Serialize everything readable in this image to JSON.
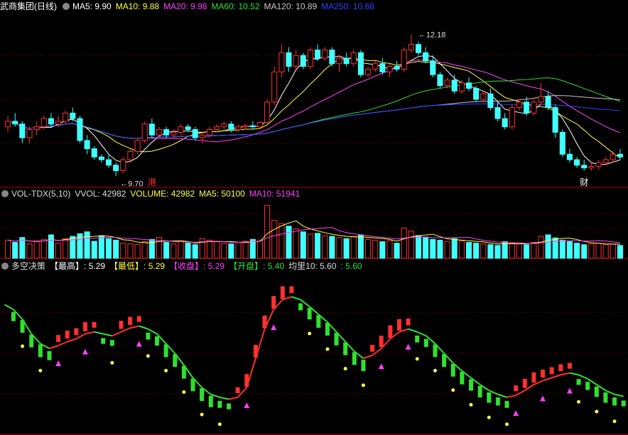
{
  "colors": {
    "up": "#ff3030",
    "down": "#40ffff",
    "ma5": "#ffffff",
    "ma10": "#ffff40",
    "ma20": "#ff40ff",
    "ma60": "#30e030",
    "ma120": "#c8c8c8",
    "ma250": "#3040ff",
    "grid": "#8b0000"
  },
  "price_panel": {
    "stock_name": "武商集团(日线)",
    "legend": [
      {
        "label": "MA5: 9.90",
        "color": "#ffffff"
      },
      {
        "label": "MA10: 9.88",
        "color": "#ffff40"
      },
      {
        "label": "MA20: 9.98",
        "color": "#ff40ff"
      },
      {
        "label": "MA60: 10.52",
        "color": "#30e030"
      },
      {
        "label": "MA120: 10.89",
        "color": "#c8c8c8"
      },
      {
        "label": "MA250: 10.68",
        "color": "#3040ff"
      }
    ],
    "high_marker": "12.18",
    "low_marker": "9.70",
    "event_marks": [
      "港",
      "财"
    ]
  },
  "volume_panel": {
    "legend": [
      {
        "label": "VOL-TDX(5,10)",
        "color": "#dddddd"
      },
      {
        "label": "VVOL: 42982",
        "color": "#dddddd"
      },
      {
        "label": "VOLUME: 42982",
        "color": "#ffff40"
      },
      {
        "label": "MA5: 50100",
        "color": "#ffff40"
      },
      {
        "label": "MA10: 51941",
        "color": "#ff40ff"
      }
    ]
  },
  "indicator_panel": {
    "legend": [
      {
        "label": "多空决策",
        "color": "#dddddd"
      },
      {
        "label": "【最高】: 5.29",
        "color": "#ffffff"
      },
      {
        "label": "【最低】: 5.29",
        "color": "#ffff40"
      },
      {
        "label": "【收盘】: 5.29",
        "color": "#ff40ff"
      },
      {
        "label": "【开盘】: 5.40",
        "color": "#30e030"
      },
      {
        "label": "均里10: 5.60",
        "color": "#dddddd"
      },
      {
        "label": ": 5.60",
        "color": "#30e030"
      }
    ]
  },
  "chart_data": [
    {
      "type": "candlestick",
      "title": "武商集团(日线)",
      "ylim": [
        9.5,
        12.5
      ],
      "ohlc": [
        [
          10.5,
          10.7,
          10.4,
          10.6
        ],
        [
          10.6,
          10.75,
          10.5,
          10.55
        ],
        [
          10.55,
          10.6,
          10.2,
          10.3
        ],
        [
          10.3,
          10.5,
          10.2,
          10.45
        ],
        [
          10.45,
          10.6,
          10.35,
          10.5
        ],
        [
          10.5,
          10.7,
          10.45,
          10.65
        ],
        [
          10.65,
          10.75,
          10.5,
          10.55
        ],
        [
          10.55,
          10.7,
          10.5,
          10.6
        ],
        [
          10.6,
          10.8,
          10.55,
          10.75
        ],
        [
          10.75,
          10.85,
          10.6,
          10.65
        ],
        [
          10.65,
          10.7,
          10.2,
          10.25
        ],
        [
          10.25,
          10.35,
          10.0,
          10.1
        ],
        [
          10.1,
          10.15,
          9.9,
          9.95
        ],
        [
          9.95,
          10.0,
          9.85,
          9.9
        ],
        [
          9.9,
          10.0,
          9.75,
          9.8
        ],
        [
          9.8,
          9.85,
          9.6,
          9.7
        ],
        [
          9.7,
          9.95,
          9.65,
          9.9
        ],
        [
          9.9,
          10.1,
          9.85,
          10.05
        ],
        [
          10.05,
          10.3,
          10.0,
          10.25
        ],
        [
          10.25,
          10.6,
          10.2,
          10.55
        ],
        [
          10.55,
          10.65,
          10.3,
          10.35
        ],
        [
          10.35,
          10.5,
          10.3,
          10.45
        ],
        [
          10.45,
          10.5,
          10.3,
          10.35
        ],
        [
          10.35,
          10.45,
          10.3,
          10.4
        ],
        [
          10.4,
          10.55,
          10.35,
          10.5
        ],
        [
          10.5,
          10.55,
          10.4,
          10.45
        ],
        [
          10.45,
          10.5,
          10.25,
          10.3
        ],
        [
          10.3,
          10.4,
          10.2,
          10.35
        ],
        [
          10.35,
          10.5,
          10.3,
          10.45
        ],
        [
          10.45,
          10.55,
          10.4,
          10.5
        ],
        [
          10.5,
          10.6,
          10.45,
          10.55
        ],
        [
          10.55,
          10.6,
          10.4,
          10.45
        ],
        [
          10.45,
          10.55,
          10.4,
          10.5
        ],
        [
          10.5,
          10.55,
          10.45,
          10.52
        ],
        [
          10.52,
          10.6,
          10.45,
          10.5
        ],
        [
          10.5,
          10.6,
          10.45,
          10.58
        ],
        [
          10.58,
          11.0,
          10.55,
          10.95
        ],
        [
          10.95,
          11.6,
          10.9,
          11.5
        ],
        [
          11.5,
          12.0,
          11.4,
          11.85
        ],
        [
          11.85,
          11.95,
          11.5,
          11.6
        ],
        [
          11.6,
          11.9,
          11.55,
          11.8
        ],
        [
          11.8,
          11.85,
          11.55,
          11.6
        ],
        [
          11.6,
          11.95,
          11.55,
          11.9
        ],
        [
          11.9,
          12.0,
          11.7,
          11.75
        ],
        [
          11.75,
          11.95,
          11.7,
          11.9
        ],
        [
          11.9,
          11.95,
          11.6,
          11.65
        ],
        [
          11.65,
          11.8,
          11.5,
          11.75
        ],
        [
          11.75,
          11.85,
          11.6,
          11.65
        ],
        [
          11.65,
          11.9,
          11.6,
          11.85
        ],
        [
          11.85,
          11.9,
          11.4,
          11.45
        ],
        [
          11.45,
          11.6,
          11.4,
          11.55
        ],
        [
          11.55,
          11.7,
          11.5,
          11.65
        ],
        [
          11.65,
          11.75,
          11.45,
          11.5
        ],
        [
          11.5,
          11.65,
          11.4,
          11.6
        ],
        [
          11.6,
          11.7,
          11.5,
          11.55
        ],
        [
          11.55,
          11.95,
          11.5,
          11.9
        ],
        [
          11.9,
          12.18,
          11.85,
          12.0
        ],
        [
          12.0,
          12.05,
          11.8,
          11.85
        ],
        [
          11.85,
          11.95,
          11.65,
          11.7
        ],
        [
          11.7,
          11.8,
          11.4,
          11.45
        ],
        [
          11.45,
          11.5,
          11.2,
          11.25
        ],
        [
          11.25,
          11.4,
          11.2,
          11.35
        ],
        [
          11.35,
          11.45,
          11.1,
          11.15
        ],
        [
          11.15,
          11.35,
          11.1,
          11.3
        ],
        [
          11.3,
          11.4,
          11.15,
          11.2
        ],
        [
          11.2,
          11.25,
          10.95,
          11.0
        ],
        [
          11.0,
          11.15,
          10.95,
          11.1
        ],
        [
          11.1,
          11.2,
          10.8,
          10.85
        ],
        [
          10.85,
          10.95,
          10.6,
          10.65
        ],
        [
          10.65,
          10.75,
          10.45,
          10.5
        ],
        [
          10.5,
          10.9,
          10.45,
          10.85
        ],
        [
          10.85,
          11.0,
          10.8,
          10.95
        ],
        [
          10.95,
          11.05,
          10.7,
          10.75
        ],
        [
          10.75,
          11.0,
          10.7,
          10.95
        ],
        [
          10.95,
          11.3,
          10.9,
          11.05
        ],
        [
          11.05,
          11.15,
          10.8,
          10.85
        ],
        [
          10.85,
          10.9,
          10.3,
          10.4
        ],
        [
          10.4,
          10.45,
          9.95,
          10.0
        ],
        [
          10.0,
          10.1,
          9.85,
          9.9
        ],
        [
          9.9,
          9.95,
          9.75,
          9.8
        ],
        [
          9.8,
          9.9,
          9.7,
          9.75
        ],
        [
          9.75,
          9.85,
          9.7,
          9.78
        ],
        [
          9.78,
          9.9,
          9.72,
          9.85
        ],
        [
          9.85,
          9.95,
          9.8,
          9.9
        ],
        [
          9.9,
          10.05,
          9.85,
          10.0
        ],
        [
          10.0,
          10.1,
          9.9,
          9.95
        ]
      ]
    },
    {
      "type": "bar",
      "title": "VOL-TDX(5,10)",
      "values": [
        48,
        42,
        55,
        38,
        44,
        50,
        62,
        40,
        52,
        58,
        65,
        70,
        45,
        60,
        52,
        48,
        40,
        38,
        36,
        44,
        50,
        55,
        42,
        38,
        46,
        40,
        36,
        52,
        48,
        44,
        40,
        38,
        42,
        45,
        50,
        48,
        140,
        100,
        92,
        85,
        78,
        70,
        64,
        66,
        60,
        58,
        55,
        52,
        58,
        62,
        50,
        48,
        44,
        46,
        40,
        80,
        72,
        60,
        56,
        50,
        48,
        44,
        52,
        46,
        42,
        40,
        38,
        36,
        34,
        44,
        40,
        38,
        36,
        42,
        58,
        62,
        54,
        48,
        44,
        40,
        36,
        38,
        40,
        36,
        38,
        34
      ]
    },
    {
      "type": "line",
      "title": "多空决策",
      "ylim": [
        4.6,
        6.2
      ],
      "values": [
        5.9,
        5.85,
        5.75,
        5.6,
        5.5,
        5.45,
        5.48,
        5.52,
        5.55,
        5.6,
        5.62,
        5.6,
        5.58,
        5.62,
        5.66,
        5.68,
        5.65,
        5.6,
        5.5,
        5.4,
        5.28,
        5.15,
        5.05,
        4.98,
        4.95,
        4.93,
        4.95,
        5.05,
        5.35,
        5.65,
        5.85,
        5.95,
        5.98,
        5.95,
        5.88,
        5.8,
        5.72,
        5.62,
        5.52,
        5.42,
        5.35,
        5.38,
        5.45,
        5.55,
        5.62,
        5.65,
        5.62,
        5.58,
        5.5,
        5.4,
        5.3,
        5.22,
        5.15,
        5.08,
        5.02,
        4.98,
        4.95,
        4.97,
        5.02,
        5.08,
        5.12,
        5.15,
        5.18,
        5.2,
        5.18,
        5.14,
        5.08,
        5.02,
        4.98,
        4.96
      ]
    }
  ]
}
